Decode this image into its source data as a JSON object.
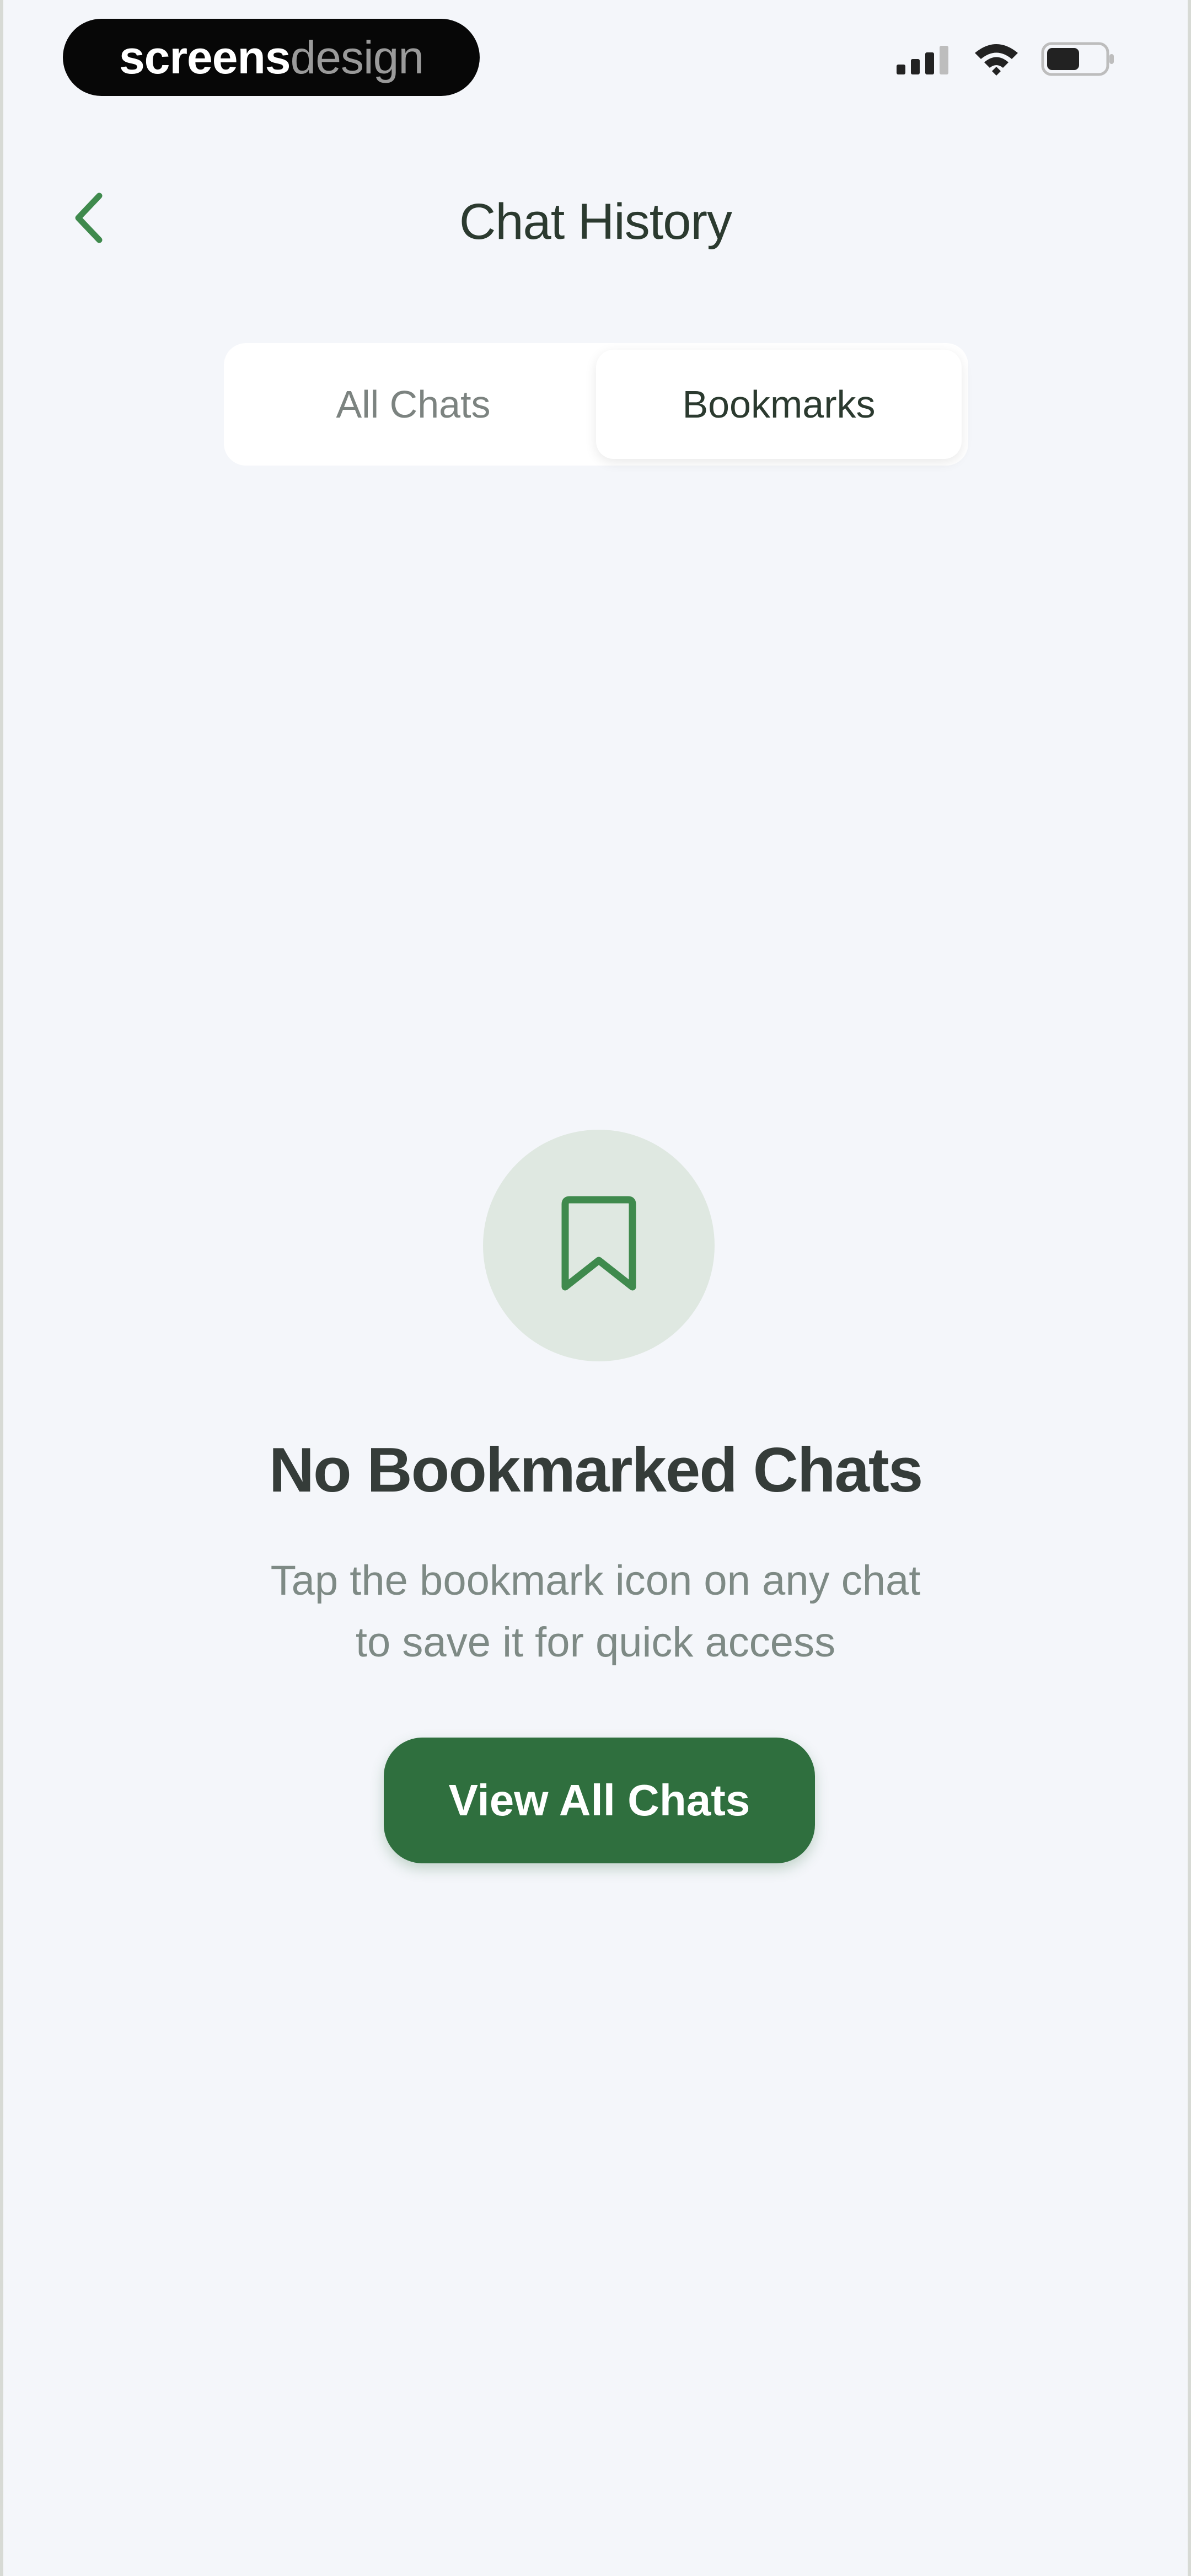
{
  "status_bar": {
    "brand_bold": "screens",
    "brand_light": "design",
    "icons": [
      "signal-icon",
      "wifi-icon",
      "battery-icon"
    ]
  },
  "header": {
    "title": "Chat History",
    "back_icon": "chevron-left-icon"
  },
  "tabs": [
    {
      "label": "All Chats",
      "active": false
    },
    {
      "label": "Bookmarks",
      "active": true
    }
  ],
  "empty_state": {
    "icon": "bookmark-icon",
    "title": "No Bookmarked Chats",
    "description_line1": "Tap the bookmark icon on any chat",
    "description_line2": "to save it for quick access",
    "button_label": "View All Chats"
  },
  "colors": {
    "accent": "#2f6f3e",
    "background": "#f4f6fa",
    "icon_circle": "#dfe8e1"
  }
}
